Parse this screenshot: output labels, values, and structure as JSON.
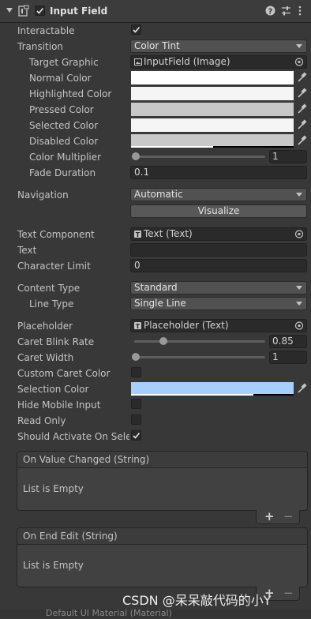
{
  "component": {
    "title": "Input Field",
    "enabled": true
  },
  "rows": {
    "interactable": {
      "label": "Interactable",
      "checked": true
    },
    "transition": {
      "label": "Transition",
      "value": "Color Tint"
    },
    "target_graphic": {
      "label": "Target Graphic",
      "value": "InputField (Image)"
    },
    "normal_color": {
      "label": "Normal Color",
      "color": "#ffffff"
    },
    "highlighted_color": {
      "label": "Highlighted Color",
      "color": "#f5f5f5"
    },
    "pressed_color": {
      "label": "Pressed Color",
      "color": "#c8c8c8"
    },
    "selected_color": {
      "label": "Selected Color",
      "color": "#f5f5f5"
    },
    "disabled_color": {
      "label": "Disabled Color",
      "color": "#c8c8c8"
    },
    "color_multiplier": {
      "label": "Color Multiplier",
      "value": "1",
      "fraction": 0.0
    },
    "fade_duration": {
      "label": "Fade Duration",
      "value": "0.1"
    },
    "navigation": {
      "label": "Navigation",
      "value": "Automatic"
    },
    "visualize": {
      "label": "Visualize"
    },
    "text_component": {
      "label": "Text Component",
      "value": "Text (Text)"
    },
    "text": {
      "label": "Text",
      "value": ""
    },
    "character_limit": {
      "label": "Character Limit",
      "value": "0"
    },
    "content_type": {
      "label": "Content Type",
      "value": "Standard"
    },
    "line_type": {
      "label": "Line Type",
      "value": "Single Line"
    },
    "placeholder": {
      "label": "Placeholder",
      "value": "Placeholder (Text)"
    },
    "caret_blink_rate": {
      "label": "Caret Blink Rate",
      "value": "0.85",
      "fraction": 0.2125
    },
    "caret_width": {
      "label": "Caret Width",
      "value": "1",
      "fraction": 0.0
    },
    "custom_caret_color": {
      "label": "Custom Caret Color",
      "checked": false
    },
    "selection_color": {
      "label": "Selection Color",
      "color": "#a8cefe"
    },
    "hide_mobile_input": {
      "label": "Hide Mobile Input",
      "checked": false
    },
    "read_only": {
      "label": "Read Only",
      "checked": false
    },
    "should_activate": {
      "label": "Should Activate On Selec",
      "checked": true
    }
  },
  "events": [
    {
      "title": "On Value Changed (String)",
      "empty_text": "List is Empty"
    },
    {
      "title": "On End Edit (String)",
      "empty_text": "List is Empty"
    }
  ],
  "list_buttons": {
    "add": "+",
    "remove": "−"
  },
  "watermark": "CSDN @呆呆敲代码的小Y",
  "bottom_label": "Default UI Material (Material)",
  "icons": {
    "fold": "foldout-arrow-icon",
    "script": "script-icon",
    "help": "help-icon",
    "presets": "presets-icon",
    "menu": "kebab-menu-icon",
    "picker": "eyedropper-icon",
    "object": "object-picker-icon"
  }
}
